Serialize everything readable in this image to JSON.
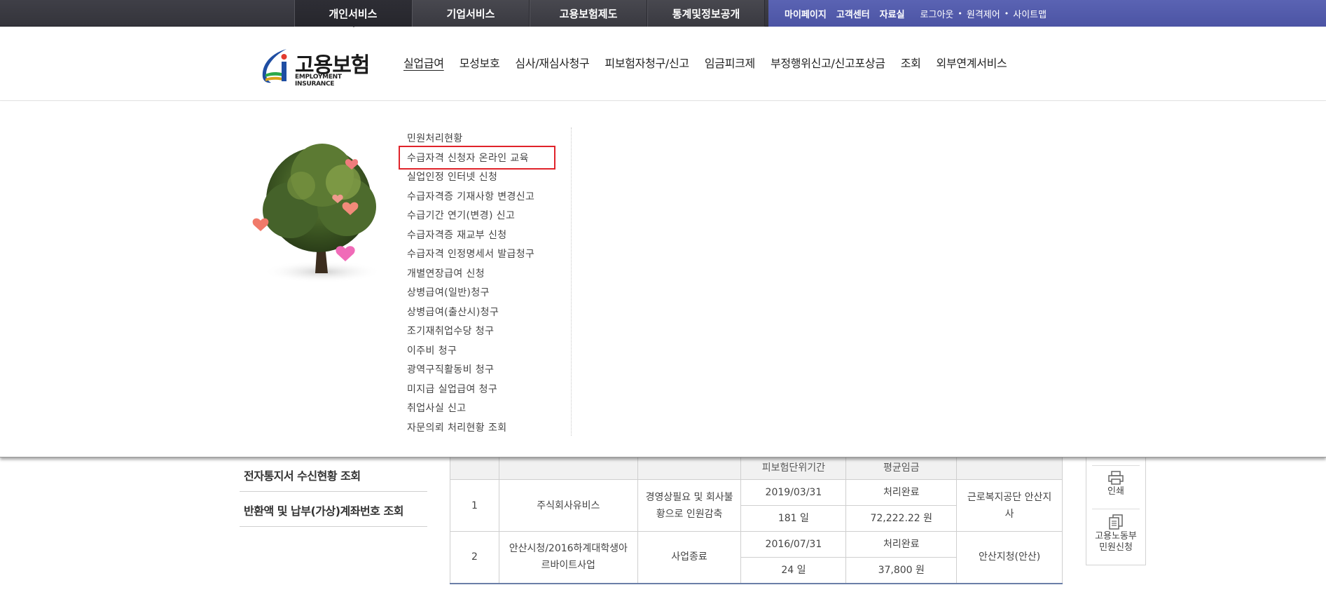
{
  "top_nav": {
    "tabs": [
      "개인서비스",
      "기업서비스",
      "고용보험제도",
      "통계및정보공개"
    ],
    "active_tab": 0
  },
  "utility": {
    "strong_links": [
      "마이페이지",
      "고객센터",
      "자료실"
    ],
    "light_links": [
      "로그아웃",
      "원격제어",
      "사이트맵"
    ]
  },
  "logo": {
    "korean": "고용보험",
    "english": "EMPLOYMENT INSURANCE"
  },
  "main_menu": {
    "items": [
      "실업급여",
      "모성보호",
      "심사/재심사청구",
      "피보험자청구/신고",
      "임금피크제",
      "부정행위신고/신고포상금",
      "조회",
      "외부연계서비스"
    ],
    "active_index": 0
  },
  "submenu": {
    "items": [
      "민원처리현황",
      "수급자격 신청자 온라인 교육",
      "실업인정 인터넷 신청",
      "수급자격증 기재사항 변경신고",
      "수급기간 연기(변경) 신고",
      "수급자격증 재교부 신청",
      "수급자격 인정명세서 발급청구",
      "개별연장급여 신청",
      "상병급여(일반)청구",
      "상병급여(출산시)청구",
      "조기재취업수당 청구",
      "이주비 청구",
      "광역구직활동비 청구",
      "미지급 실업급여 청구",
      "취업사실 신고",
      "자문의뢰 처리현황 조회"
    ],
    "highlighted_index": 1
  },
  "left_list": [
    "전자통지서 수신현황 조회",
    "반환액 및 납부(가상)계좌번호 조회"
  ],
  "table": {
    "headers": [
      "",
      "",
      "",
      "피보험단위기간",
      "평균임금",
      ""
    ],
    "rows": [
      {
        "no": "1",
        "company": "주식회사유비스",
        "reason": "경영상필요 및 회사불황으로 인원감축",
        "date": "2019/03/31",
        "status": "처리완료",
        "days": "181 일",
        "wage": "72,222.22 원",
        "office": "근로복지공단 안산지사"
      },
      {
        "no": "2",
        "company": "안산시청/2016하계대학생아르바이트사업",
        "reason": "사업종료",
        "date": "2016/07/31",
        "status": "처리완료",
        "days": "24 일",
        "wage": "37,800 원",
        "office": "안산지청(안산)"
      }
    ]
  },
  "quick_menu": {
    "print": "인쇄",
    "complaint_line1": "고용노동부",
    "complaint_line2": "민원신청"
  },
  "colors": {
    "top_bar": "#3a3a41",
    "utility_strip": "#535ba9",
    "highlight_box": "#e0232a"
  }
}
